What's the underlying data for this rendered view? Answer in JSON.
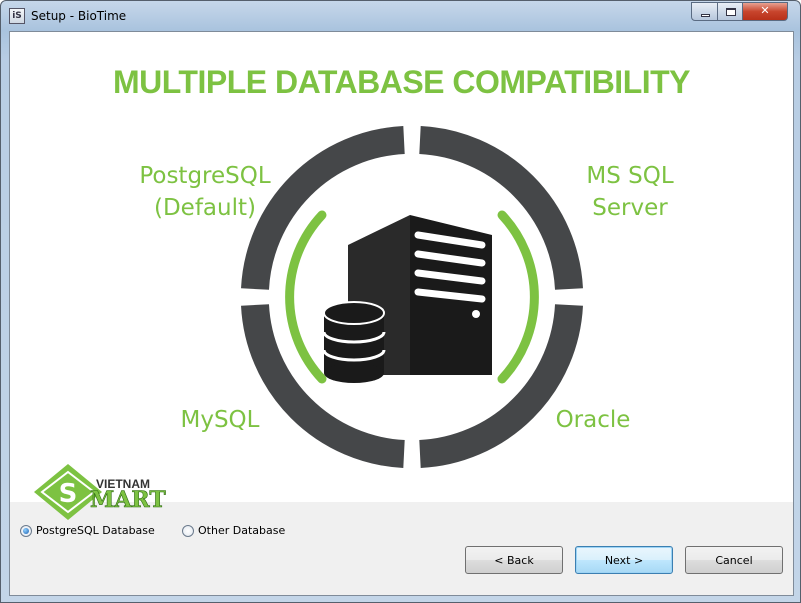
{
  "window": {
    "title": "Setup - BioTime",
    "icon": "setup-app-icon"
  },
  "banner": {
    "title": "MULTIPLE DATABASE COMPATIBILITY",
    "labels": {
      "postgres_line1": "PostgreSQL",
      "postgres_line2": "(Default)",
      "mssql": "MS SQL Server",
      "mysql": "MySQL",
      "oracle": "Oracle"
    },
    "accent_color": "#7dc242",
    "ring_color": "#454749",
    "logo": {
      "top_text": "VIETNAM",
      "bottom_text": "MART",
      "mark": "S"
    }
  },
  "options": {
    "radio_postgres": "PostgreSQL Database",
    "radio_other": "Other Database",
    "selected": "PostgreSQL Database"
  },
  "buttons": {
    "back": "< Back",
    "next": "Next >",
    "cancel": "Cancel"
  }
}
